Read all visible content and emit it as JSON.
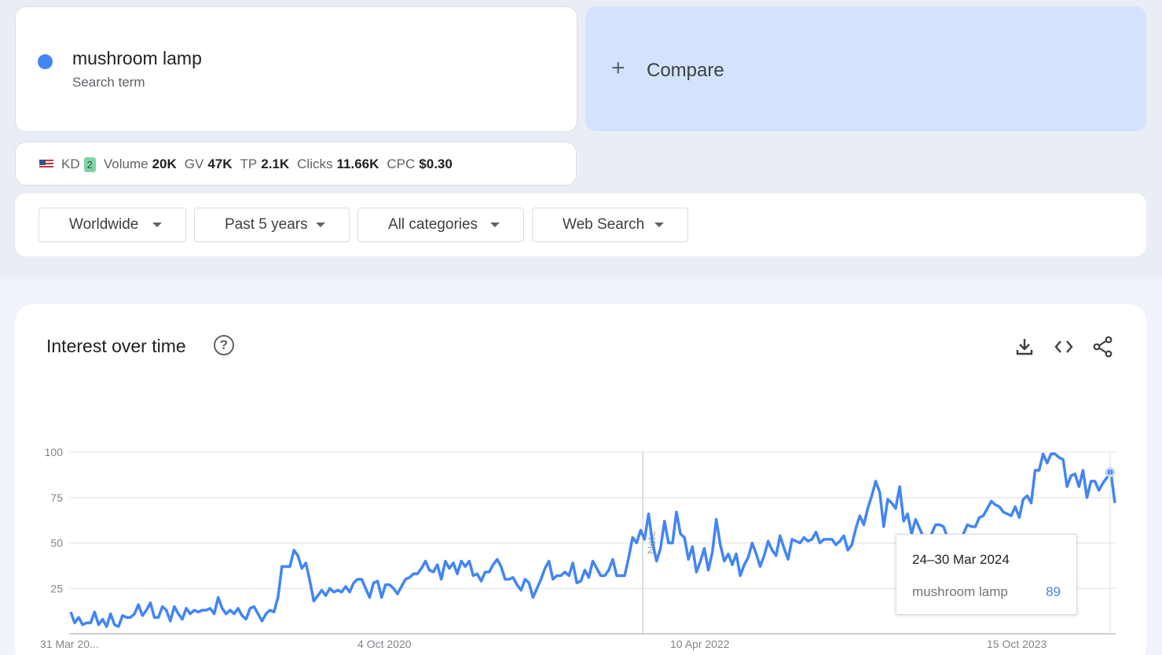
{
  "search_term": {
    "name": "mushroom lamp",
    "subtitle": "Search term",
    "color": "#4285f4"
  },
  "compare": {
    "plus": "+",
    "label": "Compare"
  },
  "metrics": {
    "kd_label": "KD",
    "kd_value": "2",
    "volume_label": "Volume",
    "volume_value": "20K",
    "gv_label": "GV",
    "gv_value": "47K",
    "tp_label": "TP",
    "tp_value": "2.1K",
    "clicks_label": "Clicks",
    "clicks_value": "11.66K",
    "cpc_label": "CPC",
    "cpc_value": "$0.30"
  },
  "filters": {
    "region": "Worldwide",
    "time_range": "Past 5 years",
    "category": "All categories",
    "search_type": "Web Search"
  },
  "chart_panel": {
    "title": "Interest over time",
    "help_icon": "?",
    "icons": [
      "download-icon",
      "embed-code-icon",
      "share-icon"
    ]
  },
  "tooltip": {
    "date": "24–30 Mar 2024",
    "term": "mushroom lamp",
    "value": "89"
  },
  "chart_data": {
    "type": "line",
    "title": "Interest over time",
    "x_tick_labels": [
      "31 Mar 20...",
      "4 Oct 2020",
      "10 Apr 2022",
      "15 Oct 2023"
    ],
    "y_ticks": [
      25,
      50,
      75,
      100
    ],
    "ylim": [
      0,
      100
    ],
    "grid": true,
    "annotation": "Note",
    "series": [
      {
        "name": "mushroom lamp",
        "color": "#4285f4",
        "values": [
          12,
          6,
          9,
          5,
          6,
          6,
          12,
          5,
          8,
          4,
          11,
          5,
          4,
          10,
          9,
          9,
          11,
          16,
          10,
          13,
          17,
          9,
          9,
          15,
          13,
          7,
          15,
          11,
          8,
          14,
          11,
          13,
          12,
          13,
          13,
          14,
          11,
          20,
          14,
          11,
          13,
          11,
          14,
          10,
          8,
          14,
          15,
          11,
          7,
          11,
          13,
          12,
          20,
          37,
          37,
          37,
          46,
          43,
          36,
          39,
          29,
          18,
          21,
          24,
          21,
          25,
          23,
          24,
          23,
          26,
          23,
          28,
          30,
          30,
          25,
          20,
          28,
          29,
          20,
          27,
          27,
          25,
          22,
          26,
          30,
          31,
          33,
          33,
          36,
          40,
          35,
          34,
          38,
          30,
          40,
          36,
          39,
          33,
          40,
          37,
          40,
          32,
          33,
          29,
          34,
          34,
          38,
          41,
          37,
          30,
          30,
          31,
          27,
          24,
          30,
          28,
          20,
          25,
          30,
          36,
          40,
          30,
          32,
          32,
          34,
          32,
          39,
          28,
          29,
          35,
          31,
          40,
          36,
          32,
          32,
          35,
          41,
          32,
          32,
          32,
          42,
          53,
          50,
          57,
          52,
          66,
          50,
          40,
          47,
          62,
          50,
          50,
          67,
          55,
          53,
          41,
          48,
          34,
          40,
          47,
          35,
          45,
          63,
          49,
          40,
          44,
          38,
          44,
          32,
          38,
          42,
          50,
          44,
          37,
          43,
          51,
          46,
          43,
          54,
          47,
          41,
          52,
          51,
          50,
          53,
          51,
          52,
          56,
          50,
          52,
          52,
          52,
          49,
          51,
          54,
          46,
          49,
          58,
          65,
          60,
          69,
          76,
          84,
          78,
          59,
          74,
          72,
          69,
          81,
          62,
          66,
          55,
          63,
          58,
          53,
          46,
          55,
          60,
          60,
          59,
          53,
          51,
          44,
          51,
          55,
          60,
          59,
          59,
          64,
          65,
          69,
          73,
          71,
          70,
          67,
          66,
          65,
          70,
          64,
          74,
          76,
          72,
          90,
          90,
          99,
          94,
          99,
          99,
          97,
          96,
          81,
          87,
          88,
          81,
          90,
          75,
          84,
          84,
          79,
          83,
          86,
          89,
          72
        ]
      }
    ]
  }
}
